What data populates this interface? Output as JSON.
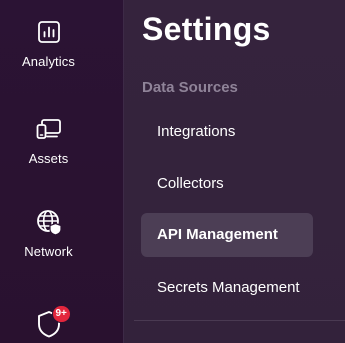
{
  "rail": {
    "items": [
      {
        "label": "Analytics",
        "icon": "analytics-icon"
      },
      {
        "label": "Assets",
        "icon": "assets-icon"
      },
      {
        "label": "Network",
        "icon": "network-globe-icon"
      },
      {
        "label": "",
        "icon": "shield-icon",
        "badge": "9+"
      }
    ]
  },
  "settings": {
    "title": "Settings",
    "section": "Data Sources",
    "items": [
      {
        "label": "Integrations",
        "active": false
      },
      {
        "label": "Collectors",
        "active": false
      },
      {
        "label": "API Management",
        "active": true
      },
      {
        "label": "Secrets Management",
        "active": false
      }
    ]
  },
  "colors": {
    "badge": "#e3263d",
    "active_item_bg": "#4c3e55",
    "section_heading": "#8f8398"
  }
}
